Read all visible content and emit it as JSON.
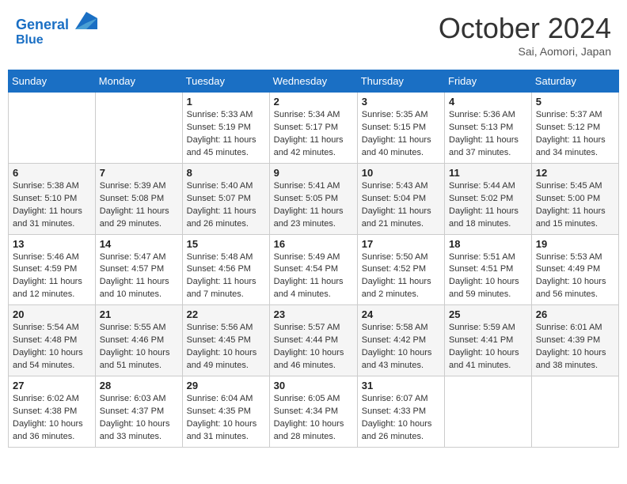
{
  "header": {
    "logo_line1": "General",
    "logo_line2": "Blue",
    "month_title": "October 2024",
    "location": "Sai, Aomori, Japan"
  },
  "weekdays": [
    "Sunday",
    "Monday",
    "Tuesday",
    "Wednesday",
    "Thursday",
    "Friday",
    "Saturday"
  ],
  "weeks": [
    [
      {
        "day": "",
        "info": ""
      },
      {
        "day": "",
        "info": ""
      },
      {
        "day": "1",
        "info": "Sunrise: 5:33 AM\nSunset: 5:19 PM\nDaylight: 11 hours and 45 minutes."
      },
      {
        "day": "2",
        "info": "Sunrise: 5:34 AM\nSunset: 5:17 PM\nDaylight: 11 hours and 42 minutes."
      },
      {
        "day": "3",
        "info": "Sunrise: 5:35 AM\nSunset: 5:15 PM\nDaylight: 11 hours and 40 minutes."
      },
      {
        "day": "4",
        "info": "Sunrise: 5:36 AM\nSunset: 5:13 PM\nDaylight: 11 hours and 37 minutes."
      },
      {
        "day": "5",
        "info": "Sunrise: 5:37 AM\nSunset: 5:12 PM\nDaylight: 11 hours and 34 minutes."
      }
    ],
    [
      {
        "day": "6",
        "info": "Sunrise: 5:38 AM\nSunset: 5:10 PM\nDaylight: 11 hours and 31 minutes."
      },
      {
        "day": "7",
        "info": "Sunrise: 5:39 AM\nSunset: 5:08 PM\nDaylight: 11 hours and 29 minutes."
      },
      {
        "day": "8",
        "info": "Sunrise: 5:40 AM\nSunset: 5:07 PM\nDaylight: 11 hours and 26 minutes."
      },
      {
        "day": "9",
        "info": "Sunrise: 5:41 AM\nSunset: 5:05 PM\nDaylight: 11 hours and 23 minutes."
      },
      {
        "day": "10",
        "info": "Sunrise: 5:43 AM\nSunset: 5:04 PM\nDaylight: 11 hours and 21 minutes."
      },
      {
        "day": "11",
        "info": "Sunrise: 5:44 AM\nSunset: 5:02 PM\nDaylight: 11 hours and 18 minutes."
      },
      {
        "day": "12",
        "info": "Sunrise: 5:45 AM\nSunset: 5:00 PM\nDaylight: 11 hours and 15 minutes."
      }
    ],
    [
      {
        "day": "13",
        "info": "Sunrise: 5:46 AM\nSunset: 4:59 PM\nDaylight: 11 hours and 12 minutes."
      },
      {
        "day": "14",
        "info": "Sunrise: 5:47 AM\nSunset: 4:57 PM\nDaylight: 11 hours and 10 minutes."
      },
      {
        "day": "15",
        "info": "Sunrise: 5:48 AM\nSunset: 4:56 PM\nDaylight: 11 hours and 7 minutes."
      },
      {
        "day": "16",
        "info": "Sunrise: 5:49 AM\nSunset: 4:54 PM\nDaylight: 11 hours and 4 minutes."
      },
      {
        "day": "17",
        "info": "Sunrise: 5:50 AM\nSunset: 4:52 PM\nDaylight: 11 hours and 2 minutes."
      },
      {
        "day": "18",
        "info": "Sunrise: 5:51 AM\nSunset: 4:51 PM\nDaylight: 10 hours and 59 minutes."
      },
      {
        "day": "19",
        "info": "Sunrise: 5:53 AM\nSunset: 4:49 PM\nDaylight: 10 hours and 56 minutes."
      }
    ],
    [
      {
        "day": "20",
        "info": "Sunrise: 5:54 AM\nSunset: 4:48 PM\nDaylight: 10 hours and 54 minutes."
      },
      {
        "day": "21",
        "info": "Sunrise: 5:55 AM\nSunset: 4:46 PM\nDaylight: 10 hours and 51 minutes."
      },
      {
        "day": "22",
        "info": "Sunrise: 5:56 AM\nSunset: 4:45 PM\nDaylight: 10 hours and 49 minutes."
      },
      {
        "day": "23",
        "info": "Sunrise: 5:57 AM\nSunset: 4:44 PM\nDaylight: 10 hours and 46 minutes."
      },
      {
        "day": "24",
        "info": "Sunrise: 5:58 AM\nSunset: 4:42 PM\nDaylight: 10 hours and 43 minutes."
      },
      {
        "day": "25",
        "info": "Sunrise: 5:59 AM\nSunset: 4:41 PM\nDaylight: 10 hours and 41 minutes."
      },
      {
        "day": "26",
        "info": "Sunrise: 6:01 AM\nSunset: 4:39 PM\nDaylight: 10 hours and 38 minutes."
      }
    ],
    [
      {
        "day": "27",
        "info": "Sunrise: 6:02 AM\nSunset: 4:38 PM\nDaylight: 10 hours and 36 minutes."
      },
      {
        "day": "28",
        "info": "Sunrise: 6:03 AM\nSunset: 4:37 PM\nDaylight: 10 hours and 33 minutes."
      },
      {
        "day": "29",
        "info": "Sunrise: 6:04 AM\nSunset: 4:35 PM\nDaylight: 10 hours and 31 minutes."
      },
      {
        "day": "30",
        "info": "Sunrise: 6:05 AM\nSunset: 4:34 PM\nDaylight: 10 hours and 28 minutes."
      },
      {
        "day": "31",
        "info": "Sunrise: 6:07 AM\nSunset: 4:33 PM\nDaylight: 10 hours and 26 minutes."
      },
      {
        "day": "",
        "info": ""
      },
      {
        "day": "",
        "info": ""
      }
    ]
  ]
}
